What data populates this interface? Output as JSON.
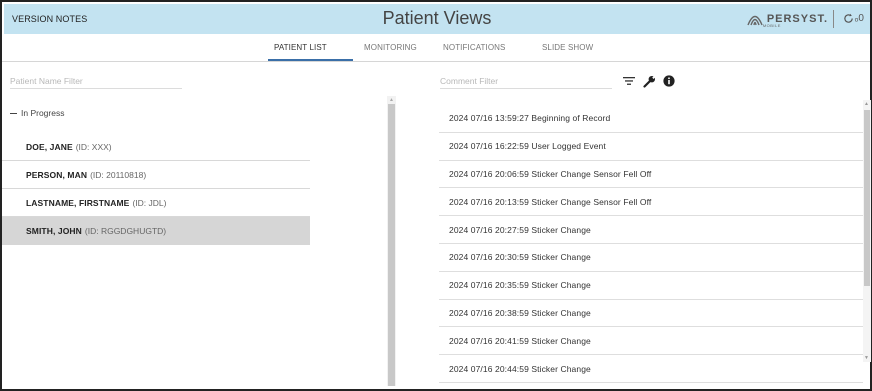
{
  "header": {
    "version_notes": "VERSION NOTES",
    "title": "Patient Views",
    "logo_text": "PERSYST.",
    "logo_sub": "MOBILE",
    "sync_icon": "sync-icon",
    "sync_suffix": "ₒ0"
  },
  "tabs": [
    {
      "label": "PATIENT LIST",
      "active": true
    },
    {
      "label": "MONITORING",
      "active": false
    },
    {
      "label": "NOTIFICATIONS",
      "active": false
    },
    {
      "label": "SLIDE SHOW",
      "active": false
    }
  ],
  "patient_filter": {
    "placeholder": "Patient Name Filter",
    "value": ""
  },
  "comment_filter": {
    "placeholder": "Comment Filter",
    "value": ""
  },
  "toolbar_icons": [
    "filter-icon",
    "wrench-icon",
    "info-icon"
  ],
  "group": {
    "label": "In Progress",
    "expanded": true
  },
  "patients": [
    {
      "name": "DOE, JANE",
      "id": "(ID: XXX)",
      "selected": false
    },
    {
      "name": "PERSON, MAN",
      "id": "(ID: 20110818)",
      "selected": false
    },
    {
      "name": "LASTNAME, FIRSTNAME",
      "id": "(ID: JDL)",
      "selected": false
    },
    {
      "name": "SMITH, JOHN",
      "id": "(ID: RGGDGHUGTD)",
      "selected": true
    }
  ],
  "comments": [
    "2024 07/16 13:59:27 Beginning of Record",
    "2024 07/16 16:22:59 User Logged Event",
    "2024 07/16 20:06:59 Sticker Change Sensor Fell Off",
    "2024 07/16 20:13:59 Sticker Change Sensor Fell Off",
    "2024 07/16 20:27:59 Sticker Change",
    "2024 07/16 20:30:59 Sticker Change",
    "2024 07/16 20:35:59 Sticker Change",
    "2024 07/16 20:38:59 Sticker Change",
    "2024 07/16 20:41:59 Sticker Change",
    "2024 07/16 20:44:59 Sticker Change"
  ],
  "colors": {
    "header_bg": "#c3e3f1",
    "selected_row": "#d6d6d6",
    "tab_underline": "#3a6fa8"
  }
}
